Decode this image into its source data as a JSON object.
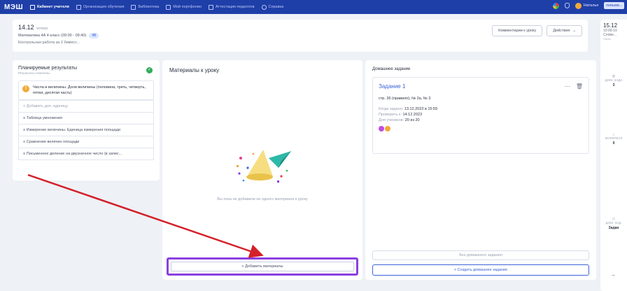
{
  "topbar": {
    "brand": "МЭШ",
    "nav": [
      {
        "label": "Кабинет учителя",
        "active": true
      },
      {
        "label": "Организация обучения",
        "active": false
      },
      {
        "label": "Библиотека",
        "active": false
      },
      {
        "label": "Мой портфолио",
        "active": false
      },
      {
        "label": "Аттестация педагогов",
        "active": false
      },
      {
        "label": "Справка",
        "active": false
      }
    ],
    "user_label": "Наталья",
    "user_pill": "пользов..."
  },
  "header": {
    "date": "14.12",
    "weekday": "четверг",
    "subject_line": "Математика 4А 4 класс (09:00 - 09:40)",
    "badge": "4В",
    "lesson_topic": "Контрольная работа за 2 бимест...",
    "comments_button": "Комментарии к уроку",
    "actions_button": "Действия"
  },
  "side_card": {
    "date": "15.12",
    "time": "10:00-10",
    "subject": "Слове...",
    "status": "Нажм.",
    "stats": [
      {
        "label": "ДОМ. ЗАДА",
        "value": "3"
      },
      {
        "label": "МАТЕРИАЛ",
        "value": "0"
      },
      {
        "label": "ДОМ. ЗАД.",
        "value": "Задан"
      }
    ]
  },
  "results_panel": {
    "title": "Планируемые результаты",
    "subtitle": "Результаты отмечены",
    "main_result": "Числа и величины. Доли величины (половина, треть, четверть, пятая, десятая часть)",
    "items": [
      {
        "label": "+ Добавить доп. единицу",
        "add": true
      },
      {
        "label": "≡ Таблица умножения",
        "add": false
      },
      {
        "label": "≡ Измерение величины. Единица измерения площади",
        "add": false
      },
      {
        "label": "≡ Сравнение величин площади",
        "add": false
      },
      {
        "label": "≡ Письменное деление на двузначное число (в запис...",
        "add": false
      }
    ]
  },
  "materials_panel": {
    "title": "Материалы к уроку",
    "empty_text": "Вы пока не добавили ни одного материала к уроку",
    "add_button": "+ Добавить материалы"
  },
  "homework_panel": {
    "title": "Домашнее задание",
    "task_title": "Задание 1",
    "task_desc": "стр. 36 (правило), № 2а, № 3",
    "meta": [
      {
        "key": "Когда задано:",
        "value": "13.12.2023 в 15:59"
      },
      {
        "key": "Проверить к:",
        "value": "14.12.2023"
      },
      {
        "key": "Для учеников:",
        "value": "20 из 20"
      }
    ],
    "no_homework_button": "Без домашнего задания",
    "create_button": "+ Создать домашнее задание"
  },
  "colors": {
    "brand_blue": "#1f3fa8",
    "highlight_purple": "#8b3fe0",
    "arrow_red": "#d4202a",
    "success_green": "#2fae5b",
    "warning_orange": "#f2a93b"
  }
}
